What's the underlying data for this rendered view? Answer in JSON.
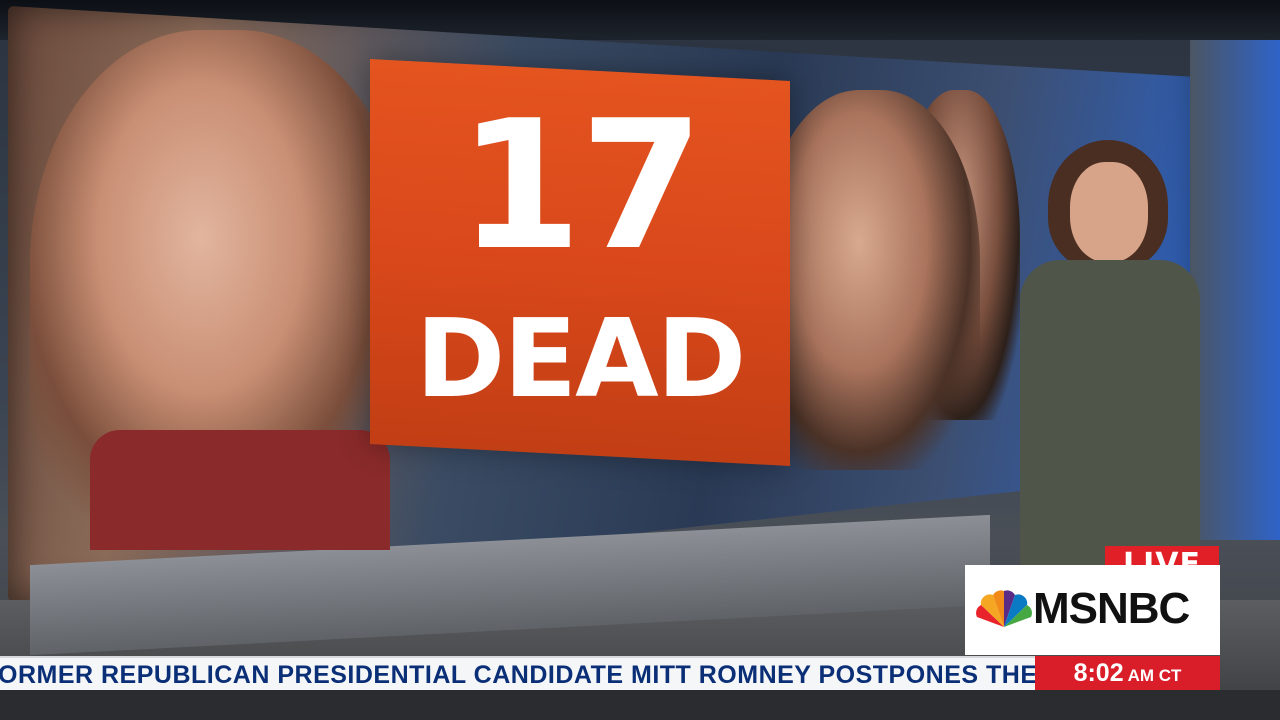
{
  "headline_graphic": {
    "number": "17",
    "word": "DEAD"
  },
  "badge": {
    "live_label": "LIVE"
  },
  "network": {
    "logo_text": "MSNBC",
    "logo_icon": "nbc-peacock-icon"
  },
  "ticker": {
    "text": "ORMER REPUBLICAN PRESIDENTIAL CANDIDATE MITT ROMNEY POSTPONES THE A"
  },
  "clock": {
    "time": "8:02",
    "zone": "AM CT"
  },
  "colors": {
    "banner_orange": "#e4541f",
    "live_red": "#e01f26",
    "ticker_text_blue": "#0b2f77",
    "clock_red": "#d91e2a"
  }
}
